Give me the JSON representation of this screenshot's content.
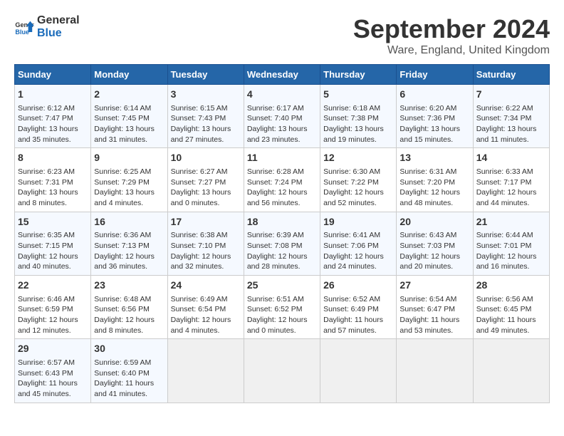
{
  "header": {
    "logo_line1": "General",
    "logo_line2": "Blue",
    "title": "September 2024",
    "location": "Ware, England, United Kingdom"
  },
  "calendar": {
    "days_of_week": [
      "Sunday",
      "Monday",
      "Tuesday",
      "Wednesday",
      "Thursday",
      "Friday",
      "Saturday"
    ],
    "weeks": [
      [
        {
          "day": "",
          "data": ""
        },
        {
          "day": "2",
          "data": "Sunrise: 6:14 AM\nSunset: 7:45 PM\nDaylight: 13 hours and 31 minutes."
        },
        {
          "day": "3",
          "data": "Sunrise: 6:15 AM\nSunset: 7:43 PM\nDaylight: 13 hours and 27 minutes."
        },
        {
          "day": "4",
          "data": "Sunrise: 6:17 AM\nSunset: 7:40 PM\nDaylight: 13 hours and 23 minutes."
        },
        {
          "day": "5",
          "data": "Sunrise: 6:18 AM\nSunset: 7:38 PM\nDaylight: 13 hours and 19 minutes."
        },
        {
          "day": "6",
          "data": "Sunrise: 6:20 AM\nSunset: 7:36 PM\nDaylight: 13 hours and 15 minutes."
        },
        {
          "day": "7",
          "data": "Sunrise: 6:22 AM\nSunset: 7:34 PM\nDaylight: 13 hours and 11 minutes."
        }
      ],
      [
        {
          "day": "8",
          "data": "Sunrise: 6:23 AM\nSunset: 7:31 PM\nDaylight: 13 hours and 8 minutes."
        },
        {
          "day": "9",
          "data": "Sunrise: 6:25 AM\nSunset: 7:29 PM\nDaylight: 13 hours and 4 minutes."
        },
        {
          "day": "10",
          "data": "Sunrise: 6:27 AM\nSunset: 7:27 PM\nDaylight: 13 hours and 0 minutes."
        },
        {
          "day": "11",
          "data": "Sunrise: 6:28 AM\nSunset: 7:24 PM\nDaylight: 12 hours and 56 minutes."
        },
        {
          "day": "12",
          "data": "Sunrise: 6:30 AM\nSunset: 7:22 PM\nDaylight: 12 hours and 52 minutes."
        },
        {
          "day": "13",
          "data": "Sunrise: 6:31 AM\nSunset: 7:20 PM\nDaylight: 12 hours and 48 minutes."
        },
        {
          "day": "14",
          "data": "Sunrise: 6:33 AM\nSunset: 7:17 PM\nDaylight: 12 hours and 44 minutes."
        }
      ],
      [
        {
          "day": "15",
          "data": "Sunrise: 6:35 AM\nSunset: 7:15 PM\nDaylight: 12 hours and 40 minutes."
        },
        {
          "day": "16",
          "data": "Sunrise: 6:36 AM\nSunset: 7:13 PM\nDaylight: 12 hours and 36 minutes."
        },
        {
          "day": "17",
          "data": "Sunrise: 6:38 AM\nSunset: 7:10 PM\nDaylight: 12 hours and 32 minutes."
        },
        {
          "day": "18",
          "data": "Sunrise: 6:39 AM\nSunset: 7:08 PM\nDaylight: 12 hours and 28 minutes."
        },
        {
          "day": "19",
          "data": "Sunrise: 6:41 AM\nSunset: 7:06 PM\nDaylight: 12 hours and 24 minutes."
        },
        {
          "day": "20",
          "data": "Sunrise: 6:43 AM\nSunset: 7:03 PM\nDaylight: 12 hours and 20 minutes."
        },
        {
          "day": "21",
          "data": "Sunrise: 6:44 AM\nSunset: 7:01 PM\nDaylight: 12 hours and 16 minutes."
        }
      ],
      [
        {
          "day": "22",
          "data": "Sunrise: 6:46 AM\nSunset: 6:59 PM\nDaylight: 12 hours and 12 minutes."
        },
        {
          "day": "23",
          "data": "Sunrise: 6:48 AM\nSunset: 6:56 PM\nDaylight: 12 hours and 8 minutes."
        },
        {
          "day": "24",
          "data": "Sunrise: 6:49 AM\nSunset: 6:54 PM\nDaylight: 12 hours and 4 minutes."
        },
        {
          "day": "25",
          "data": "Sunrise: 6:51 AM\nSunset: 6:52 PM\nDaylight: 12 hours and 0 minutes."
        },
        {
          "day": "26",
          "data": "Sunrise: 6:52 AM\nSunset: 6:49 PM\nDaylight: 11 hours and 57 minutes."
        },
        {
          "day": "27",
          "data": "Sunrise: 6:54 AM\nSunset: 6:47 PM\nDaylight: 11 hours and 53 minutes."
        },
        {
          "day": "28",
          "data": "Sunrise: 6:56 AM\nSunset: 6:45 PM\nDaylight: 11 hours and 49 minutes."
        }
      ],
      [
        {
          "day": "29",
          "data": "Sunrise: 6:57 AM\nSunset: 6:43 PM\nDaylight: 11 hours and 45 minutes."
        },
        {
          "day": "30",
          "data": "Sunrise: 6:59 AM\nSunset: 6:40 PM\nDaylight: 11 hours and 41 minutes."
        },
        {
          "day": "",
          "data": ""
        },
        {
          "day": "",
          "data": ""
        },
        {
          "day": "",
          "data": ""
        },
        {
          "day": "",
          "data": ""
        },
        {
          "day": "",
          "data": ""
        }
      ]
    ],
    "first_week_sunday": {
      "day": "1",
      "data": "Sunrise: 6:12 AM\nSunset: 7:47 PM\nDaylight: 13 hours and 35 minutes."
    }
  }
}
